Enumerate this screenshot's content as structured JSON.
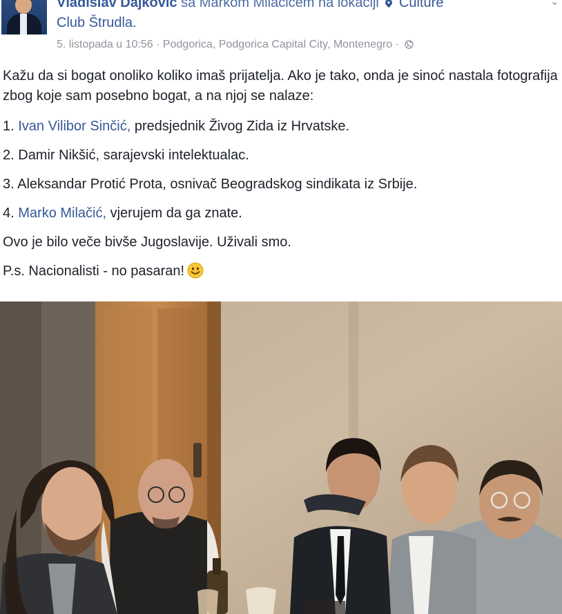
{
  "post": {
    "author": "Vladislav Dajković",
    "with_text": "sa Markom Milačićem na lokaciji",
    "location_part1": "Culture",
    "location_part2": "Club Štrudla.",
    "timestamp": "5. listopada u 10:56",
    "place": "· Podgorica, Podgorica Capital City, Montenegro ·",
    "intro": "Kažu da si bogat onoliko koliko imaš prijatelja. Ako je tako, onda je sinoć nastala fotografija zbog koje sam posebno bogat, a na njoj se nalaze:",
    "items": [
      {
        "num": "1.",
        "name": "Ivan Vilibor Sinčić,",
        "rest": " predsjednik Živog Zida iz Hrvatske."
      },
      {
        "num": "2.",
        "name": "",
        "rest": " Damir Nikšić, sarajevski intelektualac."
      },
      {
        "num": "3.",
        "name": "",
        "rest": " Aleksandar Protić Prota, osnivač Beogradskog sindikata iz Srbije."
      },
      {
        "num": "4.",
        "name": "Marko Milačić,",
        "rest": " vjerujem da ga znate."
      }
    ],
    "closing": "Ovo je bilo veče bivše Jugoslavije. Uživali smo.",
    "ps": "P.s. Nacionalisti - no pasaran!"
  },
  "icons": {
    "pin": "location-pin-icon",
    "globe": "globe-icon",
    "smiley": "smiley-icon",
    "chevron": "chevron-down-icon"
  },
  "colors": {
    "link": "#365899",
    "text": "#1d2129",
    "meta": "#90949c"
  }
}
